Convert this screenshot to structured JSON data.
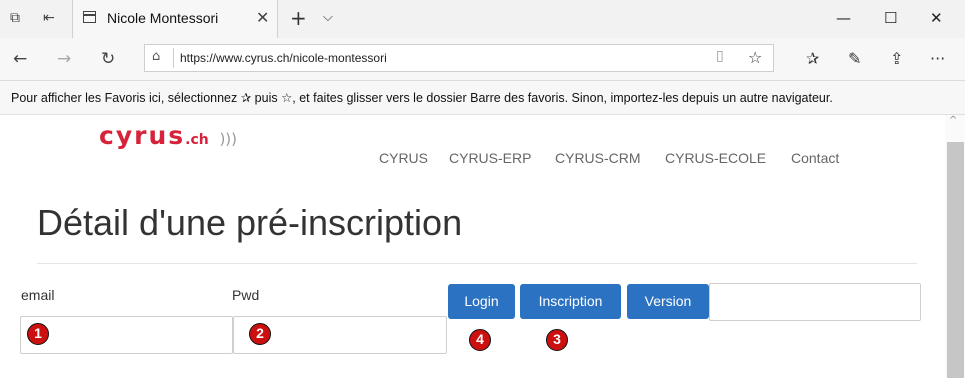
{
  "browser": {
    "tab_title": "Nicole Montessori",
    "url": "https://www.cyrus.ch/nicole-montessori",
    "favorites_hint": "Pour afficher les Favoris ici, sélectionnez ✰ puis ☆, et faites glisser vers le dossier Barre des favoris. Sinon, importez-les depuis un autre navigateur.",
    "icons": {
      "tab_actions": "⧉",
      "tab_back": "⇤",
      "close_tab": "✕",
      "new_tab": "+",
      "tab_list": "⌵",
      "minimize": "—",
      "maximize": "☐",
      "close": "✕",
      "back": "←",
      "forward": "→",
      "refresh": "↻",
      "lock": "⌂",
      "reading_view": "▯",
      "favorite_star": "☆",
      "favorites_hub": "✰",
      "pen": "✎",
      "share": "⇪",
      "more": "···"
    }
  },
  "site": {
    "logo": {
      "text": "cyrus",
      "tld": ".ch",
      "waves": ")))"
    },
    "nav": [
      "CYRUS",
      "CYRUS-ERP",
      "CYRUS-CRM",
      "CYRUS-ECOLE",
      "Contact"
    ],
    "page_title": "Détail d'une pré-inscription",
    "form": {
      "email_label": "email",
      "email_value": "",
      "pwd_label": "Pwd",
      "pwd_value": "",
      "login_button": "Login",
      "inscription_button": "Inscription",
      "version_button": "Version",
      "extra_value": ""
    },
    "markers": [
      "1",
      "2",
      "3",
      "4"
    ]
  }
}
